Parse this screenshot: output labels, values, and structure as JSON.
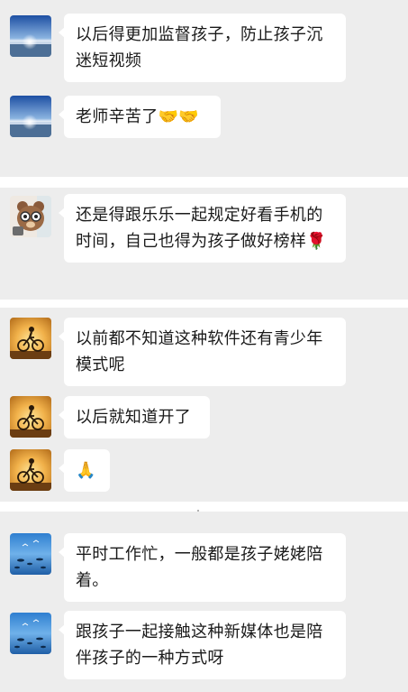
{
  "chat": {
    "messages": [
      {
        "avatar": "sea-sunrise-avatar",
        "text": "以后得更加监督孩子，防止孩子沉迷短视频"
      },
      {
        "avatar": "sea-sunrise-avatar",
        "text": "老师辛苦了🤝🤝"
      },
      {
        "avatar": "bear-glasses-avatar",
        "text": "还是得跟乐乐一起规定好看手机的时间，自己也得为孩子做好榜样🌹"
      },
      {
        "avatar": "cyclist-sunset-avatar",
        "text": "以前都不知道这种软件还有青少年模式呢"
      },
      {
        "avatar": "cyclist-sunset-avatar",
        "text": "以后就知道开了"
      },
      {
        "avatar": "cyclist-sunset-avatar",
        "text": "🙏"
      },
      {
        "avatar": "sea-birds-avatar",
        "text": "平时工作忙，一般都是孩子姥姥陪着。"
      },
      {
        "avatar": "sea-birds-avatar",
        "text": "跟孩子一起接触这种新媒体也是陪伴孩子的一种方式呀"
      }
    ]
  }
}
